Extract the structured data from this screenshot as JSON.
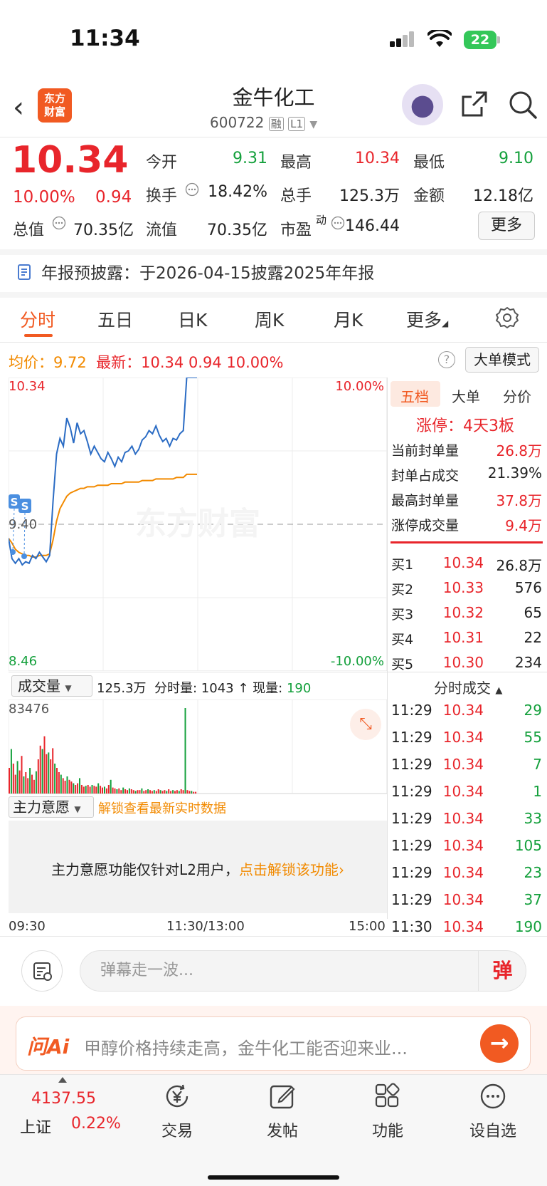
{
  "status_bar": {
    "time": "11:34",
    "battery": "22"
  },
  "header": {
    "logo_line1": "东方",
    "logo_line2": "财富",
    "stock_name": "金牛化工",
    "stock_code": "600722",
    "tag1": "融",
    "tag2": "L1"
  },
  "quote": {
    "price": "10.34",
    "change_pct": "10.00%",
    "change": "0.94",
    "fields": [
      {
        "label": "今开",
        "value": "9.31",
        "color": "#14a03c"
      },
      {
        "label": "最高",
        "value": "10.34",
        "color": "#e8252b"
      },
      {
        "label": "最低",
        "value": "9.10",
        "color": "#14a03c"
      },
      {
        "label": "换手",
        "value": "18.42%",
        "color": "#222222"
      },
      {
        "label": "总手",
        "value": "125.3万",
        "color": "#222222"
      },
      {
        "label": "金额",
        "value": "12.18亿",
        "color": "#222222"
      },
      {
        "label": "总值",
        "value": "70.35亿",
        "color": "#222222"
      },
      {
        "label": "流值",
        "value": "70.35亿",
        "color": "#222222"
      },
      {
        "label": "市盈",
        "value": "146.44",
        "color": "#222222"
      }
    ],
    "pe_sup": "动",
    "more_label": "更多"
  },
  "notice": "年报预披露：于2026-04-15披露2025年年报",
  "tabs": [
    "分时",
    "五日",
    "日K",
    "周K",
    "月K",
    "更多"
  ],
  "chart_info": {
    "avg_label": "均价：",
    "avg_value": "9.72",
    "latest_label": "最新：",
    "latest_value": "10.34",
    "latest_change": "0.94",
    "latest_pct": "10.00%",
    "help": "?",
    "bigorder_label": "大单模式"
  },
  "chart_axes": {
    "y_top": "10.34",
    "y_mid": "9.40",
    "y_bottom": "8.46",
    "pct_top": "10.00%",
    "pct_bottom": "-10.00%",
    "vol_max": "83476",
    "watermark": "东方财富",
    "marker": "S"
  },
  "chart_data": {
    "type": "line",
    "ylim": [
      8.46,
      10.34
    ],
    "baseline": 9.4,
    "x_labels": [
      "09:30",
      "11:30/13:00",
      "15:00"
    ],
    "series": [
      {
        "name": "最新",
        "values": [
          9.31,
          9.18,
          9.15,
          9.18,
          9.14,
          9.16,
          9.15,
          9.2,
          9.18,
          9.22,
          9.19,
          9.16,
          9.2,
          9.55,
          9.85,
          9.95,
          9.9,
          10.08,
          10.02,
          9.92,
          10.05,
          9.98,
          10.0,
          9.93,
          9.85,
          9.9,
          9.86,
          9.82,
          9.8,
          9.86,
          9.82,
          9.77,
          9.83,
          9.8,
          9.86,
          9.87,
          9.9,
          9.85,
          9.88,
          9.94,
          9.96,
          10.0,
          9.98,
          10.03,
          9.97,
          9.93,
          9.95,
          9.9,
          9.95,
          9.94,
          9.98,
          10.0,
          10.34,
          10.34,
          10.34,
          10.34
        ]
      },
      {
        "name": "均价",
        "values": [
          9.31,
          9.28,
          9.24,
          9.22,
          9.21,
          9.2,
          9.2,
          9.19,
          9.19,
          9.2,
          9.2,
          9.2,
          9.21,
          9.3,
          9.42,
          9.5,
          9.54,
          9.58,
          9.6,
          9.61,
          9.62,
          9.63,
          9.63,
          9.64,
          9.64,
          9.64,
          9.65,
          9.65,
          9.65,
          9.65,
          9.66,
          9.66,
          9.66,
          9.66,
          9.67,
          9.67,
          9.67,
          9.67,
          9.67,
          9.68,
          9.68,
          9.68,
          9.68,
          9.69,
          9.69,
          9.69,
          9.69,
          9.69,
          9.69,
          9.7,
          9.7,
          9.7,
          9.72,
          9.72,
          9.72,
          9.72
        ]
      }
    ],
    "volume": {
      "max": 83476,
      "bars": [
        0.3,
        0.52,
        0.35,
        0.22,
        0.38,
        0.27,
        0.44,
        0.2,
        0.25,
        0.18,
        0.3,
        0.22,
        0.16,
        0.26,
        0.4,
        0.56,
        0.52,
        0.67,
        0.46,
        0.48,
        0.4,
        0.53,
        0.35,
        0.3,
        0.25,
        0.22,
        0.18,
        0.15,
        0.2,
        0.16,
        0.14,
        0.12,
        0.1,
        0.12,
        0.18,
        0.1,
        0.08,
        0.09,
        0.1,
        0.08,
        0.1,
        0.09,
        0.08,
        0.12,
        0.09,
        0.07,
        0.08,
        0.06,
        0.1,
        0.16,
        0.07,
        0.06,
        0.05,
        0.06,
        0.04,
        0.07,
        0.05,
        0.04,
        0.06,
        0.05,
        0.04,
        0.03,
        0.04,
        0.04,
        0.06,
        0.03,
        0.04,
        0.05,
        0.04,
        0.03,
        0.04,
        0.03,
        0.05,
        0.04,
        0.03,
        0.04,
        0.03,
        0.05,
        0.03,
        0.04,
        0.03,
        0.04,
        0.03,
        0.05,
        0.04,
        1.0,
        0.04,
        0.03,
        0.03,
        0.02,
        0.02
      ]
    }
  },
  "side_tabs": [
    "五档",
    "大单",
    "分价"
  ],
  "limit_up": {
    "title": "涨停：4天3板",
    "rows": [
      {
        "label": "当前封单量",
        "value": "26.8万",
        "color": "#e8252b"
      },
      {
        "label": "封单占成交",
        "value": "21.39%",
        "color": "#222222"
      },
      {
        "label": "最高封单量",
        "value": "37.8万",
        "color": "#e8252b"
      },
      {
        "label": "涨停成交量",
        "value": "9.4万",
        "color": "#e8252b"
      }
    ]
  },
  "order_book": [
    {
      "label": "买1",
      "price": "10.34",
      "volume": "26.8万"
    },
    {
      "label": "买2",
      "price": "10.33",
      "volume": "576"
    },
    {
      "label": "买3",
      "price": "10.32",
      "volume": "65"
    },
    {
      "label": "买4",
      "price": "10.31",
      "volume": "22"
    },
    {
      "label": "买5",
      "price": "10.30",
      "volume": "234"
    }
  ],
  "trades_header": "分时成交",
  "trades": [
    {
      "time": "11:29",
      "price": "10.34",
      "volume": "29"
    },
    {
      "time": "11:29",
      "price": "10.34",
      "volume": "55"
    },
    {
      "time": "11:29",
      "price": "10.34",
      "volume": "7"
    },
    {
      "time": "11:29",
      "price": "10.34",
      "volume": "1"
    },
    {
      "time": "11:29",
      "price": "10.34",
      "volume": "33"
    },
    {
      "time": "11:29",
      "price": "10.34",
      "volume": "105"
    },
    {
      "time": "11:29",
      "price": "10.34",
      "volume": "23"
    },
    {
      "time": "11:29",
      "price": "10.34",
      "volume": "37"
    },
    {
      "time": "11:30",
      "price": "10.34",
      "volume": "190"
    }
  ],
  "volume_bar": {
    "selector": "成交量",
    "total": "125.3万",
    "period_label": "分时量:",
    "period_value": "1043",
    "arrow": "↑",
    "current_label": "现量:",
    "current_value": "190"
  },
  "force": {
    "selector": "主力意愿",
    "unlock_hint": "解锁查看最新实时数据",
    "message": "主力意愿功能仅针对L2用户，",
    "message_link": "点击解锁该功能"
  },
  "time_axis": [
    "09:30",
    "11:30/13:00",
    "15:00"
  ],
  "danmaku": {
    "placeholder": "弹幕走一波...",
    "button": "弹"
  },
  "ai": {
    "logo": "问Ai",
    "text": "甲醇价格持续走高，金牛化工能否迎来业...",
    "go": "→"
  },
  "bottom_nav": {
    "index_value": "4137.55",
    "index_name": "上证",
    "index_pct": "0.22%",
    "items": [
      "交易",
      "发帖",
      "功能",
      "设自选"
    ]
  },
  "colors": {
    "up": "#e8252b",
    "down": "#14a03c",
    "accent": "#f15a22",
    "avg": "#f28a00",
    "price_line": "#2b6cc4"
  }
}
